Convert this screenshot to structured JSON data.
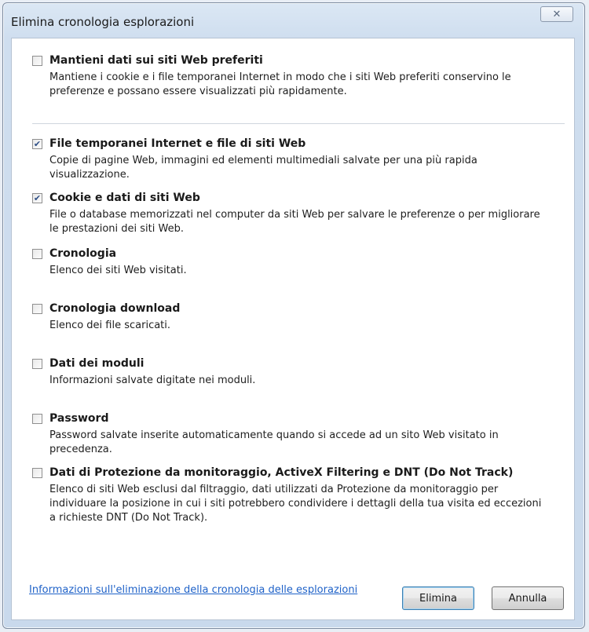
{
  "window": {
    "title": "Elimina cronologia esplorazioni",
    "close_glyph": "✕"
  },
  "options": [
    {
      "label": "Mantieni dati sui siti Web preferiti",
      "checked": false,
      "desc_lines": [
        "Mantiene i cookie e i file temporanei Internet in modo che i siti Web preferiti conservino le",
        "preferenze e possano essere visualizzati più rapidamente."
      ]
    },
    {
      "label": "File temporanei Internet e file di siti Web",
      "checked": true,
      "desc_lines": [
        "Copie di pagine Web, immagini ed elementi multimediali salvate per una più rapida",
        "visualizzazione."
      ]
    },
    {
      "label": "Cookie e dati di siti Web",
      "checked": true,
      "desc_lines": [
        "File o database memorizzati nel computer da siti Web per salvare le preferenze o per migliorare",
        "le prestazioni dei siti Web."
      ]
    },
    {
      "label": "Cronologia",
      "checked": false,
      "desc_lines": [
        "Elenco dei siti Web visitati."
      ]
    },
    {
      "label": "Cronologia download",
      "checked": false,
      "desc_lines": [
        "Elenco dei file scaricati."
      ]
    },
    {
      "label": "Dati dei moduli",
      "checked": false,
      "desc_lines": [
        "Informazioni salvate digitate nei moduli."
      ]
    },
    {
      "label": "Password",
      "checked": false,
      "desc_lines": [
        "Password salvate inserite automaticamente quando si accede ad un sito Web visitato in",
        "precedenza."
      ]
    },
    {
      "label": "Dati di Protezione da monitoraggio, ActiveX Filtering e DNT (Do Not Track)",
      "checked": false,
      "desc_lines": [
        "Elenco di siti Web esclusi dal filtraggio, dati utilizzati da Protezione da monitoraggio per",
        "individuare la posizione in cui i siti potrebbero condividere i dettagli della tua visita ed eccezioni",
        "a richieste DNT (Do Not Track)."
      ]
    }
  ],
  "footer": {
    "help_link": "Informazioni sull'eliminazione della cronologia delle esplorazioni",
    "delete_label": "Elimina",
    "cancel_label": "Annulla"
  },
  "colors": {
    "link": "#1f62c8",
    "check": "#2f4f86"
  }
}
